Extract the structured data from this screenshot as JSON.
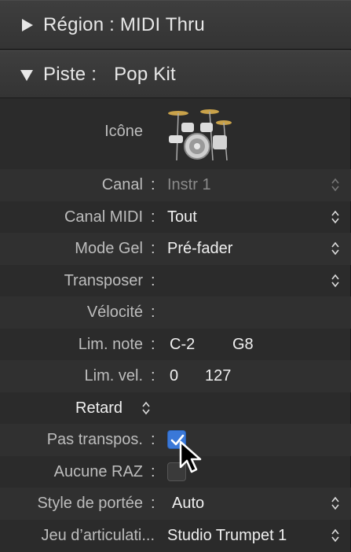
{
  "headers": {
    "region": "Région : MIDI Thru",
    "track_label": "Piste :",
    "track_name": "Pop Kit"
  },
  "icon_row": {
    "label": "Icône",
    "icon": "drum-kit-icon"
  },
  "rows": {
    "channel": {
      "label": "Canal",
      "value": "Instr 1"
    },
    "midi_channel": {
      "label": "Canal MIDI",
      "value": "Tout"
    },
    "freeze_mode": {
      "label": "Mode Gel",
      "value": "Pré-fader"
    },
    "transpose": {
      "label": "Transposer",
      "value": ""
    },
    "velocity": {
      "label": "Vélocité",
      "value": ""
    },
    "note_limit": {
      "label": "Lim. note",
      "low": "C-2",
      "high": "G8"
    },
    "vel_limit": {
      "label": "Lim. vel.",
      "low": "0",
      "high": "127"
    },
    "delay": {
      "label": "Retard"
    },
    "no_transpose": {
      "label": "Pas transpos.",
      "checked": true
    },
    "no_reset": {
      "label": "Aucune RAZ",
      "checked": false
    },
    "staff_style": {
      "label": "Style de portée",
      "value": "Auto"
    },
    "articulation_set": {
      "label": "Jeu d’articulati...",
      "value": "Studio Trumpet 1"
    }
  },
  "colors": {
    "accent": "#3a78d8",
    "background": "#2b2b2b"
  }
}
